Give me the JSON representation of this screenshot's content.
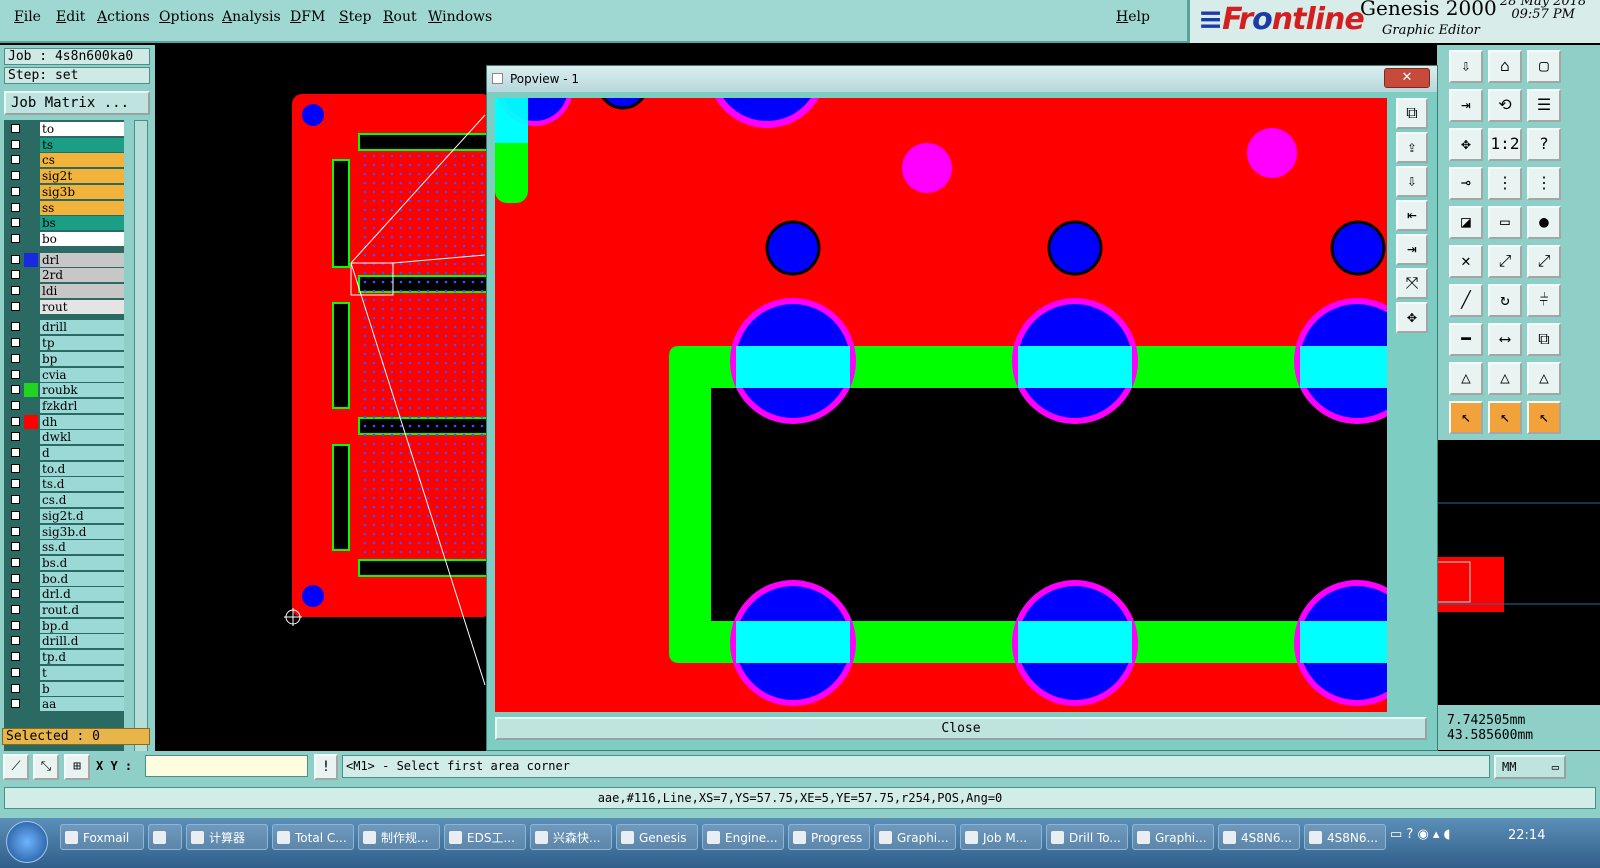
{
  "menu": {
    "items": [
      "File",
      "Edit",
      "Actions",
      "Options",
      "Analysis",
      "DFM",
      "Step",
      "Rout",
      "Windows"
    ],
    "help": "Help"
  },
  "brand": {
    "logo_prefix": "Fr",
    "logo_o": "o",
    "logo_suffix": "ntline",
    "product": "Genesis 2000",
    "subtitle": "Graphic Editor",
    "date": "28 May 2018",
    "time": "09:57 PM"
  },
  "job": {
    "job_label": "Job : 4s8n600ka0",
    "step_label": "Step: set",
    "matrix_button": "Job Matrix ..."
  },
  "layers": [
    {
      "name": "to",
      "bg": "#ffffff",
      "swatch": ""
    },
    {
      "name": "ts",
      "bg": "#1a9e86",
      "swatch": ""
    },
    {
      "name": "cs",
      "bg": "#f2b33d",
      "swatch": ""
    },
    {
      "name": "sig2t",
      "bg": "#f2b33d",
      "swatch": ""
    },
    {
      "name": "sig3b",
      "bg": "#f2b33d",
      "swatch": ""
    },
    {
      "name": "ss",
      "bg": "#f2b33d",
      "swatch": ""
    },
    {
      "name": "bs",
      "bg": "#1a9e86",
      "swatch": ""
    },
    {
      "name": "bo",
      "bg": "#ffffff",
      "swatch": ""
    },
    {
      "name": "drl",
      "bg": "#c7c7c7",
      "swatch": "#1a28e0"
    },
    {
      "name": "2rd",
      "bg": "#c7c7c7",
      "swatch": ""
    },
    {
      "name": "ldi",
      "bg": "#c7c7c7",
      "swatch": ""
    },
    {
      "name": "rout",
      "bg": "#e4e4e4",
      "swatch": ""
    },
    {
      "name": "drill",
      "bg": "#9ad9d6",
      "swatch": ""
    },
    {
      "name": "tp",
      "bg": "#9ad9d6",
      "swatch": ""
    },
    {
      "name": "bp",
      "bg": "#9ad9d6",
      "swatch": ""
    },
    {
      "name": "cvia",
      "bg": "#9ad9d6",
      "swatch": ""
    },
    {
      "name": "roubk",
      "bg": "#9ad9d6",
      "swatch": "#22d422"
    },
    {
      "name": "fzkdrl",
      "bg": "#9ad9d6",
      "swatch": ""
    },
    {
      "name": "dh",
      "bg": "#9ad9d6",
      "swatch": "#ff0000"
    },
    {
      "name": "dwkl",
      "bg": "#9ad9d6",
      "swatch": ""
    },
    {
      "name": "d",
      "bg": "#9ad9d6",
      "swatch": ""
    },
    {
      "name": "to.d",
      "bg": "#9ad9d6",
      "swatch": ""
    },
    {
      "name": "ts.d",
      "bg": "#9ad9d6",
      "swatch": ""
    },
    {
      "name": "cs.d",
      "bg": "#9ad9d6",
      "swatch": ""
    },
    {
      "name": "sig2t.d",
      "bg": "#9ad9d6",
      "swatch": ""
    },
    {
      "name": "sig3b.d",
      "bg": "#9ad9d6",
      "swatch": ""
    },
    {
      "name": "ss.d",
      "bg": "#9ad9d6",
      "swatch": ""
    },
    {
      "name": "bs.d",
      "bg": "#9ad9d6",
      "swatch": ""
    },
    {
      "name": "bo.d",
      "bg": "#9ad9d6",
      "swatch": ""
    },
    {
      "name": "drl.d",
      "bg": "#9ad9d6",
      "swatch": ""
    },
    {
      "name": "rout.d",
      "bg": "#9ad9d6",
      "swatch": ""
    },
    {
      "name": "bp.d",
      "bg": "#9ad9d6",
      "swatch": ""
    },
    {
      "name": "drill.d",
      "bg": "#9ad9d6",
      "swatch": ""
    },
    {
      "name": "tp.d",
      "bg": "#9ad9d6",
      "swatch": ""
    },
    {
      "name": "t",
      "bg": "#9ad9d6",
      "swatch": ""
    },
    {
      "name": "b",
      "bg": "#9ad9d6",
      "swatch": ""
    },
    {
      "name": "aa",
      "bg": "#9ad9d6",
      "swatch": ""
    }
  ],
  "selected_label": "Selected : 0",
  "popview": {
    "title": "Popview - 1",
    "close_label": "Close"
  },
  "coords": {
    "x": "7.742505mm",
    "y": "43.585600mm"
  },
  "command": {
    "xy_label": "X Y :",
    "xy_value": "",
    "prompt": "<M1> - Select first area corner",
    "units": "MM"
  },
  "status": "aae,#116,Line,XS=7,YS=57.75,XE=5,YE=57.75,r254,POS,Ang=0",
  "taskbar": {
    "items": [
      "Foxmail",
      "",
      "计算器",
      "Total C...",
      "制作规...",
      "EDS工...",
      "兴森快...",
      "Genesis",
      "Engine...",
      "Progress",
      "Graphi...",
      "Job M...",
      "Drill To...",
      "Graphi...",
      "4S8N6...",
      "4S8N6..."
    ],
    "clock": "22:14"
  },
  "colors": {
    "board": "#ff0000",
    "trace": "#00ff00",
    "pad_blue": "#0000ff",
    "mask": "#ff00ff",
    "overlap": "#00ffff",
    "panel": "#8ed0c8"
  }
}
